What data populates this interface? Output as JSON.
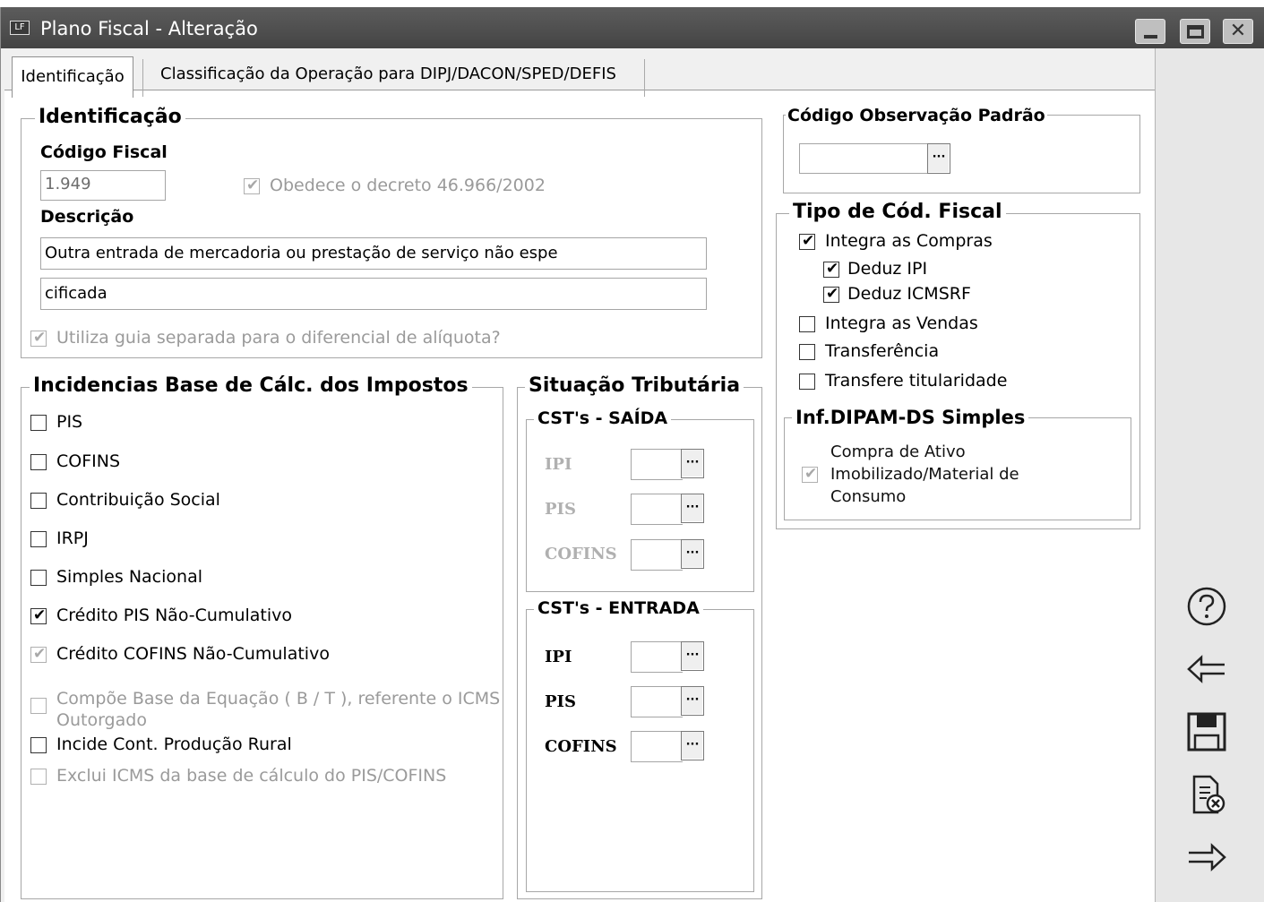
{
  "window": {
    "title": "Plano Fiscal - Alteração",
    "app_icon_text": "LF",
    "close_glyph": "✕"
  },
  "tabs": [
    {
      "label": "Identificação"
    },
    {
      "label": "Classificação da Operação para DIPJ/DACON/SPED/DEFIS"
    }
  ],
  "identificacao": {
    "group_title": "Identificação",
    "codigo_label": "Código Fiscal",
    "codigo_value": "1.949",
    "decreto_label": "Obedece o decreto 46.966/2002",
    "descricao_label": "Descrição",
    "descricao_line1": "Outra entrada de mercadoria ou prestação de serviço não espe",
    "descricao_line2": "cificada",
    "guia_label": "Utiliza guia separada para o diferencial de alíquota?"
  },
  "observacao": {
    "group_title": "Código Observação Padrão",
    "value": "",
    "button": "···"
  },
  "tipo_cod_fiscal": {
    "group_title": "Tipo de Cód. Fiscal",
    "items": [
      {
        "label": "Integra as Compras",
        "checked": true
      },
      {
        "label": "Deduz IPI",
        "checked": true
      },
      {
        "label": "Deduz ICMSRF",
        "checked": true
      },
      {
        "label": "Integra as Vendas",
        "checked": false
      },
      {
        "label": "Transferência",
        "checked": false
      },
      {
        "label": "Transfere titularidade",
        "checked": false
      }
    ]
  },
  "dipam": {
    "group_title": "Inf.DIPAM-DS Simples",
    "line1": "Compra de Ativo",
    "line2": "Imobilizado/Material de",
    "line3": "Consumo"
  },
  "incidencias": {
    "group_title": "Incidencias Base de Cálc. dos Impostos",
    "items": [
      {
        "label": "PIS",
        "checked": false,
        "enabled": true
      },
      {
        "label": "COFINS",
        "checked": false,
        "enabled": true
      },
      {
        "label": "Contribuição Social",
        "checked": false,
        "enabled": true
      },
      {
        "label": "IRPJ",
        "checked": false,
        "enabled": true
      },
      {
        "label": "Simples Nacional",
        "checked": false,
        "enabled": true
      },
      {
        "label": "Crédito PIS Não-Cumulativo",
        "checked": true,
        "enabled": true
      },
      {
        "label": "Crédito COFINS Não-Cumulativo",
        "checked": true,
        "enabled": true
      },
      {
        "label": "Compõe Base da Equação ( B / T ), referente o ICMS",
        "label2": "Outorgado",
        "checked": false,
        "enabled": false
      },
      {
        "label": "Incide Cont. Produção Rural",
        "checked": false,
        "enabled": true
      },
      {
        "label": "Exclui ICMS da base de cálculo do PIS/COFINS",
        "checked": false,
        "enabled": false
      }
    ]
  },
  "situacao": {
    "group_title": "Situação Tributária",
    "saida_title": "CST's - SAÍDA",
    "entrada_title": "CST's - ENTRADA",
    "saida": [
      {
        "label": "IPI"
      },
      {
        "label": "PIS"
      },
      {
        "label": "COFINS"
      }
    ],
    "entrada": [
      {
        "label": "IPI"
      },
      {
        "label": "PIS"
      },
      {
        "label": "COFINS"
      }
    ],
    "button": "···"
  },
  "side_actions": [
    {
      "icon": "help-icon"
    },
    {
      "icon": "back-arrow-icon"
    },
    {
      "icon": "save-icon"
    },
    {
      "icon": "cancel-document-icon"
    },
    {
      "icon": "forward-arrow-icon"
    }
  ],
  "tick": "✔"
}
